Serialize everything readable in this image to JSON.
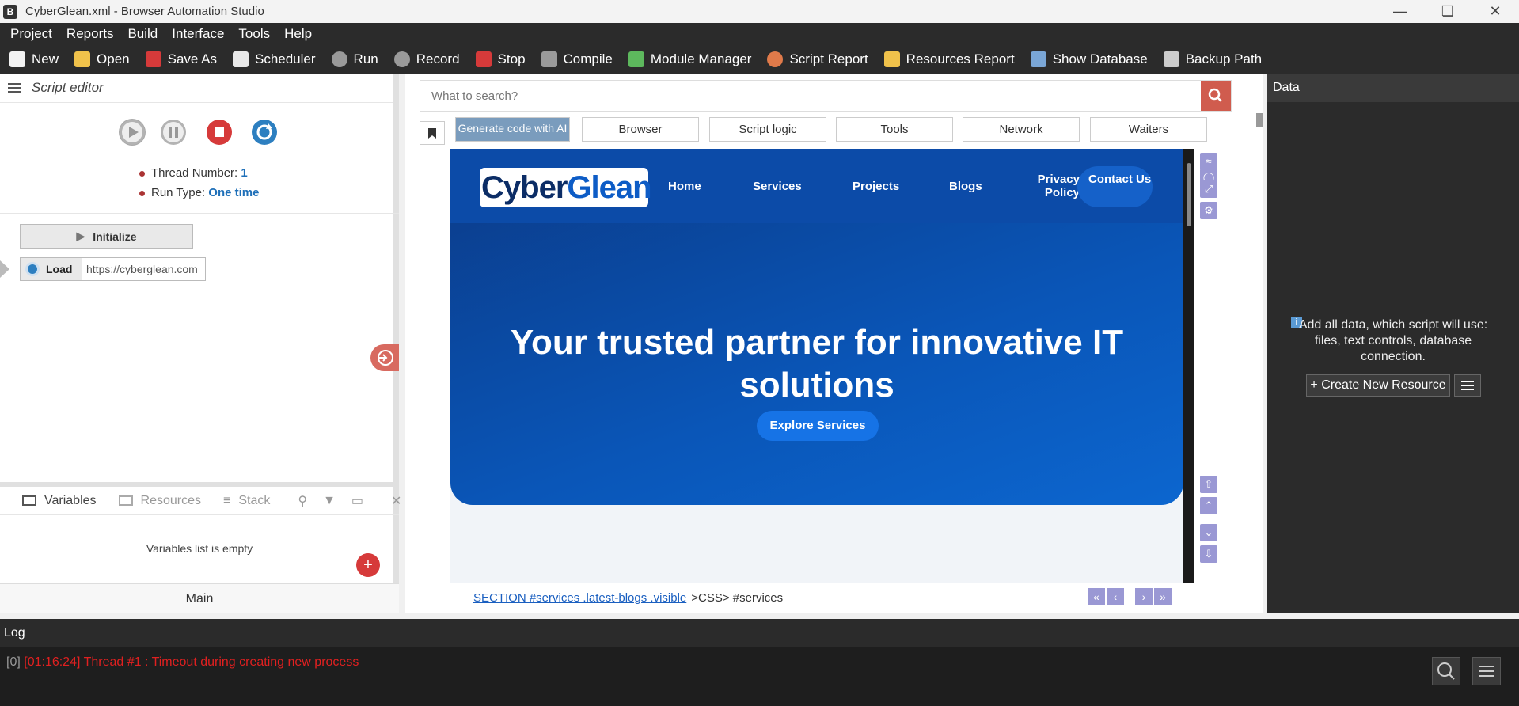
{
  "window": {
    "title": "CyberGlean.xml - Browser Automation Studio",
    "app_icon": "B"
  },
  "menu": [
    "Project",
    "Reports",
    "Build",
    "Interface",
    "Tools",
    "Help"
  ],
  "toolbar": [
    {
      "label": "New",
      "icon": "new-file-icon",
      "color": "#f2f2f2"
    },
    {
      "label": "Open",
      "icon": "folder-icon",
      "color": "#f0c24b"
    },
    {
      "label": "Save As",
      "icon": "floppy-icon",
      "color": "#d63a3a"
    },
    {
      "label": "Scheduler",
      "icon": "calendar-icon",
      "color": "#e8e8e8"
    },
    {
      "label": "Run",
      "icon": "play-icon",
      "color": "#9a9a9a"
    },
    {
      "label": "Record",
      "icon": "record-icon",
      "color": "#9a9a9a"
    },
    {
      "label": "Stop",
      "icon": "stop-icon",
      "color": "#d63a3a"
    },
    {
      "label": "Compile",
      "icon": "cube-icon",
      "color": "#9a9a9a"
    },
    {
      "label": "Module Manager",
      "icon": "puzzle-icon",
      "color": "#5db85d"
    },
    {
      "label": "Script Report",
      "icon": "pie-chart-icon",
      "color": "#e07a4a"
    },
    {
      "label": "Resources Report",
      "icon": "notepad-icon",
      "color": "#f0c24b"
    },
    {
      "label": "Show Database",
      "icon": "database-icon",
      "color": "#7aa6d6"
    },
    {
      "label": "Backup Path",
      "icon": "backup-icon",
      "color": "#cccccc"
    }
  ],
  "script_editor": {
    "title": "Script editor",
    "thread_label": "Thread Number:",
    "thread_value": "1",
    "runtype_label": "Run Type:",
    "runtype_value": "One time",
    "initialize": "Initialize",
    "load_label": "Load",
    "load_url": "https://cyberglean.com"
  },
  "vars_tabs": {
    "variables": "Variables",
    "resources": "Resources",
    "stack": "Stack"
  },
  "vars_empty": "Variables list is empty",
  "main_label": "Main",
  "center": {
    "search_placeholder": "What to search?",
    "tabs": [
      "Generate code with AI",
      "Browser",
      "Script logic",
      "Tools",
      "Network",
      "Waiters"
    ]
  },
  "site": {
    "logo_part1": "Cyber",
    "logo_part2": "Glean",
    "nav": [
      "Home",
      "Services",
      "Projects",
      "Blogs",
      "Privacy Policy"
    ],
    "contact": "Contact Us",
    "hero_title": "Your trusted partner for innovative IT solutions",
    "explore": "Explore Services"
  },
  "breadcrumb": {
    "link": "SECTION #services .latest-blogs .visible",
    "selector": ">CSS> #services"
  },
  "data_panel": {
    "title": "Data",
    "info": "Add all data, which script will use: files, text controls, database connection.",
    "create": "+ Create New Resource"
  },
  "log": {
    "title": "Log",
    "index": "[0]",
    "message": "[01:16:24] Thread #1 : Timeout during creating new process"
  }
}
